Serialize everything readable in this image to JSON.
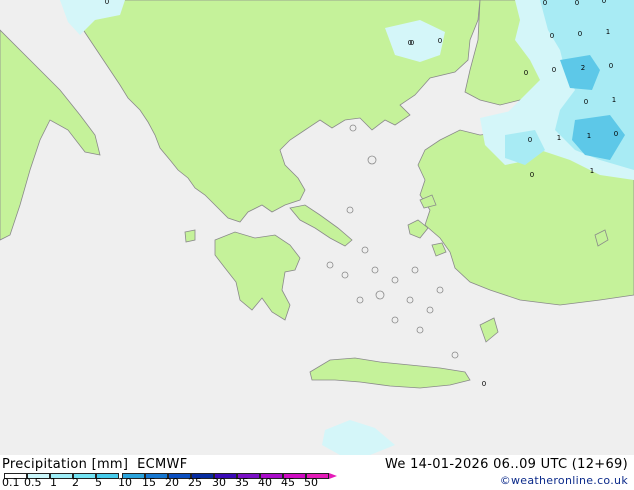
{
  "header": {
    "legend_title": "Precipitation [mm]",
    "model": "ECMWF",
    "datetime": "We 14-01-2026 06..09 UTC (12+69)",
    "credit": "©weatheronline.co.uk"
  },
  "colors": {
    "sea": "#efefef",
    "land": "#c5f29a",
    "coast": "#8a8a8a",
    "precip_light": "#d4f6f9",
    "precip_mid": "#a8ebf4",
    "precip_heavy": "#5dc8e8"
  },
  "scale": {
    "labels": [
      "0.1",
      "0.5",
      "1",
      "2",
      "5",
      "10",
      "15",
      "20",
      "25",
      "30",
      "35",
      "40",
      "45",
      "50"
    ],
    "colors": [
      "#ffffff",
      "#cbf7fb",
      "#9feef8",
      "#73e3f3",
      "#46cbeb",
      "#2aa3dc",
      "#1677d0",
      "#0b4fc0",
      "#062ca0",
      "#3a0ab6",
      "#7a10c6",
      "#a90cc9",
      "#cf0cc2",
      "#e41bb8"
    ]
  },
  "point_values": [
    "0",
    "0",
    "0",
    "0",
    "0",
    "1",
    "0",
    "0",
    "2",
    "0",
    "0",
    "1",
    "0",
    "1",
    "1",
    "0",
    "0",
    "1",
    "0",
    "0",
    "0",
    "0",
    "0"
  ]
}
